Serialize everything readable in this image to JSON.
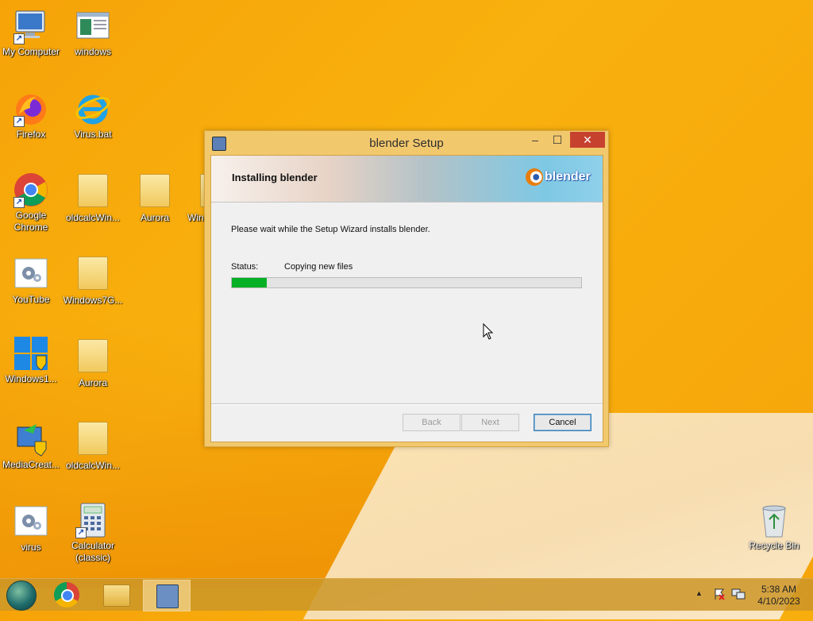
{
  "desktop": {
    "icons": [
      {
        "label": "My Computer"
      },
      {
        "label": "windows"
      },
      {
        "label": "Firefox"
      },
      {
        "label": "Virus.bat"
      },
      {
        "label": "Google Chrome"
      },
      {
        "label": "oldcalcWin..."
      },
      {
        "label": "Aurora"
      },
      {
        "label": "Win"
      },
      {
        "label": "YouTube"
      },
      {
        "label": "Windows7G..."
      },
      {
        "label": "Windows1..."
      },
      {
        "label": "Aurora"
      },
      {
        "label": "MediaCreat..."
      },
      {
        "label": "oldcalcWin..."
      },
      {
        "label": "virus"
      },
      {
        "label": "Calculator (classic)"
      },
      {
        "label": "Recycle Bin"
      }
    ]
  },
  "dialog": {
    "title": "blender Setup",
    "banner_title": "Installing blender",
    "logo_text": "blender",
    "wait_text": "Please wait while the Setup Wizard installs blender.",
    "status_label": "Status:",
    "status_value": "Copying new files",
    "progress_fraction": 0.1,
    "buttons": {
      "back": "Back",
      "next": "Next",
      "cancel": "Cancel"
    },
    "minimize_glyph": "–",
    "maximize_glyph": "☐",
    "close_glyph": "✕"
  },
  "taskbar": {
    "clock_time": "5:38 AM",
    "clock_date": "4/10/2023",
    "tray_expand_glyph": "▲"
  },
  "colors": {
    "progress_fill": "#06b025",
    "close_button": "#c7412f",
    "wallpaper": "#f6a308"
  }
}
